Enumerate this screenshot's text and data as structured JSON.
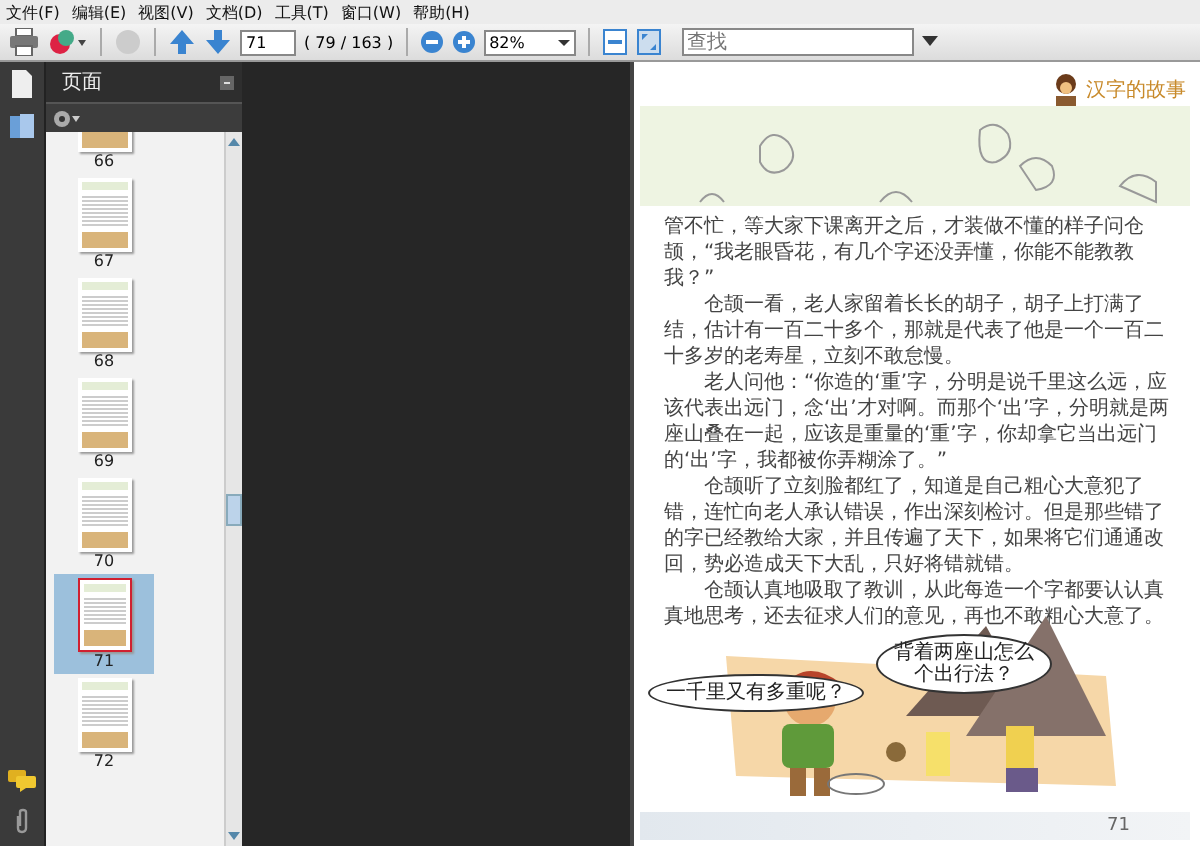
{
  "menu_bar": [
    {
      "label": "文件(F)"
    },
    {
      "label": "编辑(E)"
    },
    {
      "label": "视图(V)"
    },
    {
      "label": "文档(D)"
    },
    {
      "label": "工具(T)"
    },
    {
      "label": "窗口(W)"
    },
    {
      "label": "帮助(H)"
    }
  ],
  "toolbar": {
    "page_number": "71",
    "page_count": "( 79 / 163 )",
    "zoom": "82%",
    "search": {
      "placeholder": "查找"
    }
  },
  "sidebar": {
    "title": "页面",
    "thumbnails": [
      {
        "label": "66",
        "selected": false
      },
      {
        "label": "67",
        "selected": false
      },
      {
        "label": "68",
        "selected": false
      },
      {
        "label": "69",
        "selected": false
      },
      {
        "label": "70",
        "selected": false
      },
      {
        "label": "71",
        "selected": true
      },
      {
        "label": "72",
        "selected": false
      }
    ]
  },
  "document": {
    "header_title": "汉字的故事",
    "paragraphs": [
      "管不忙，等大家下课离开之后，才装做不懂的样子问仓颉，“我老眼昏花，有几个字还没弄懂，你能不能教教我？”",
      "仓颉一看，老人家留着长长的胡子，胡子上打满了结，估计有一百二十多个，那就是代表了他是一个一百二十多岁的老寿星，立刻不敢怠慢。",
      "老人问他：“你造的‘重’字，分明是说千里这么远，应该代表出远门，念‘出’才对啊。而那个‘出’字，分明就是两座山叠在一起，应该是重量的‘重’字，你却拿它当出远门的‘出’字，我都被你弄糊涂了。”",
      "仓颉听了立刻脸都红了，知道是自己粗心大意犯了错，连忙向老人承认错误，作出深刻检讨。但是那些错了的字已经教给大家，并且传遍了天下，如果将它们通通改回，势必造成天下大乱，只好将错就错。",
      "仓颉认真地吸取了教训，从此每造一个字都要认认真真地思考，还去征求人们的意见，再也不敢粗心大意了。"
    ],
    "speech_bubbles": [
      "一千里又有多重呢？",
      "背着两座山怎么个出行法？"
    ],
    "page_number": "71"
  }
}
